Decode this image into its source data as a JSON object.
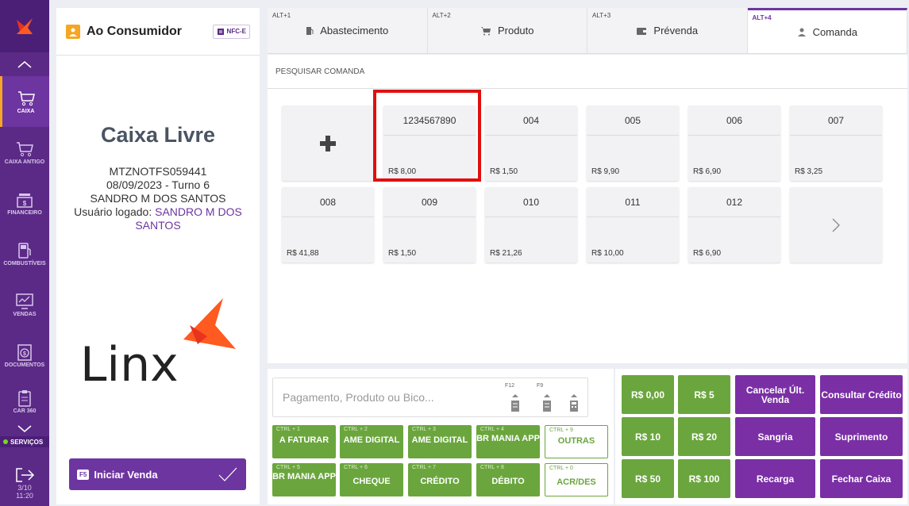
{
  "sidebar": {
    "items": [
      {
        "label": "CAIXA",
        "icon": "cart-icon"
      },
      {
        "label": "CAIXA ANTIGO",
        "icon": "cart-icon"
      },
      {
        "label": "FINANCEIRO",
        "icon": "cash-register-icon"
      },
      {
        "label": "COMBUSTÍVEIS",
        "icon": "fuel-pump-icon"
      },
      {
        "label": "VENDAS",
        "icon": "monitor-chart-icon"
      },
      {
        "label": "DOCUMENTOS",
        "icon": "document-money-icon"
      },
      {
        "label": "CAR 360",
        "icon": "clipboard-icon"
      }
    ],
    "services_label": "SERVIÇOS",
    "date": "3/10",
    "time": "11:20"
  },
  "customer": {
    "name": "Ao Consumidor",
    "doc_type": "NFC-E",
    "status": "Caixa Livre",
    "terminal": "MTZNOTFS059441",
    "date_shift": "08/09/2023 - Turno 6",
    "operator": "SANDRO M DOS SANTOS",
    "user_label": "Usuário logado: ",
    "user_name": "SANDRO M DOS SANTOS",
    "start_key": "F5",
    "start_label": "Iniciar Venda"
  },
  "tabs": [
    {
      "key": "ALT+1",
      "label": "Abastecimento",
      "icon": "fuel-icon"
    },
    {
      "key": "ALT+2",
      "label": "Produto",
      "icon": "cart-icon"
    },
    {
      "key": "ALT+3",
      "label": "Prévenda",
      "icon": "wallet-icon"
    },
    {
      "key": "ALT+4",
      "label": "Comanda",
      "icon": "user-icon"
    }
  ],
  "search": {
    "placeholder": "PESQUISAR COMANDA"
  },
  "comandas": [
    {
      "num": "1234567890",
      "price": "R$ 8,00"
    },
    {
      "num": "004",
      "price": "R$ 1,50"
    },
    {
      "num": "005",
      "price": "R$ 9,90"
    },
    {
      "num": "006",
      "price": "R$ 6,90"
    },
    {
      "num": "007",
      "price": "R$ 3,25"
    },
    {
      "num": "008",
      "price": "R$ 41,88"
    },
    {
      "num": "009",
      "price": "R$ 1,50"
    },
    {
      "num": "010",
      "price": "R$ 21,26"
    },
    {
      "num": "011",
      "price": "R$ 10,00"
    },
    {
      "num": "012",
      "price": "R$ 6,90"
    }
  ],
  "payment": {
    "placeholder": "Pagamento, Produto ou Bico...",
    "keys": [
      {
        "key": "F12"
      },
      {
        "key": "F9"
      },
      {
        "key": ""
      }
    ],
    "buttons": [
      {
        "key": "CTRL + 1",
        "label": "A FATURAR"
      },
      {
        "key": "CTRL + 2",
        "label": "AME DIGITAL"
      },
      {
        "key": "CTRL + 3",
        "label": "AME DIGITAL"
      },
      {
        "key": "CTRL + 4",
        "label": "BR MANIA APP"
      },
      {
        "key": "CTRL + 9",
        "label": "OUTRAS"
      },
      {
        "key": "CTRL + 5",
        "label": "BR MANIA APP"
      },
      {
        "key": "CTRL + 6",
        "label": "CHEQUE"
      },
      {
        "key": "CTRL + 7",
        "label": "CRÉDITO"
      },
      {
        "key": "CTRL + 8",
        "label": "DÉBITO"
      },
      {
        "key": "CTRL + 0",
        "label": "ACR/DES"
      }
    ]
  },
  "quick": {
    "r0": "R$ 0,00",
    "r5": "R$ 5",
    "r10": "R$ 10",
    "r20": "R$ 20",
    "r50": "R$ 50",
    "r100": "R$ 100",
    "cancel": "Cancelar Últ. Venda",
    "credit": "Consultar Crédito",
    "sangria": "Sangria",
    "suprimento": "Suprimento",
    "recarga": "Recarga",
    "fechar": "Fechar Caixa"
  },
  "colors": {
    "brand": "#5b2a86",
    "accent": "#f5a623",
    "green": "#6aa63d",
    "purple": "#7a2fa5",
    "highlight": "#e01010"
  }
}
